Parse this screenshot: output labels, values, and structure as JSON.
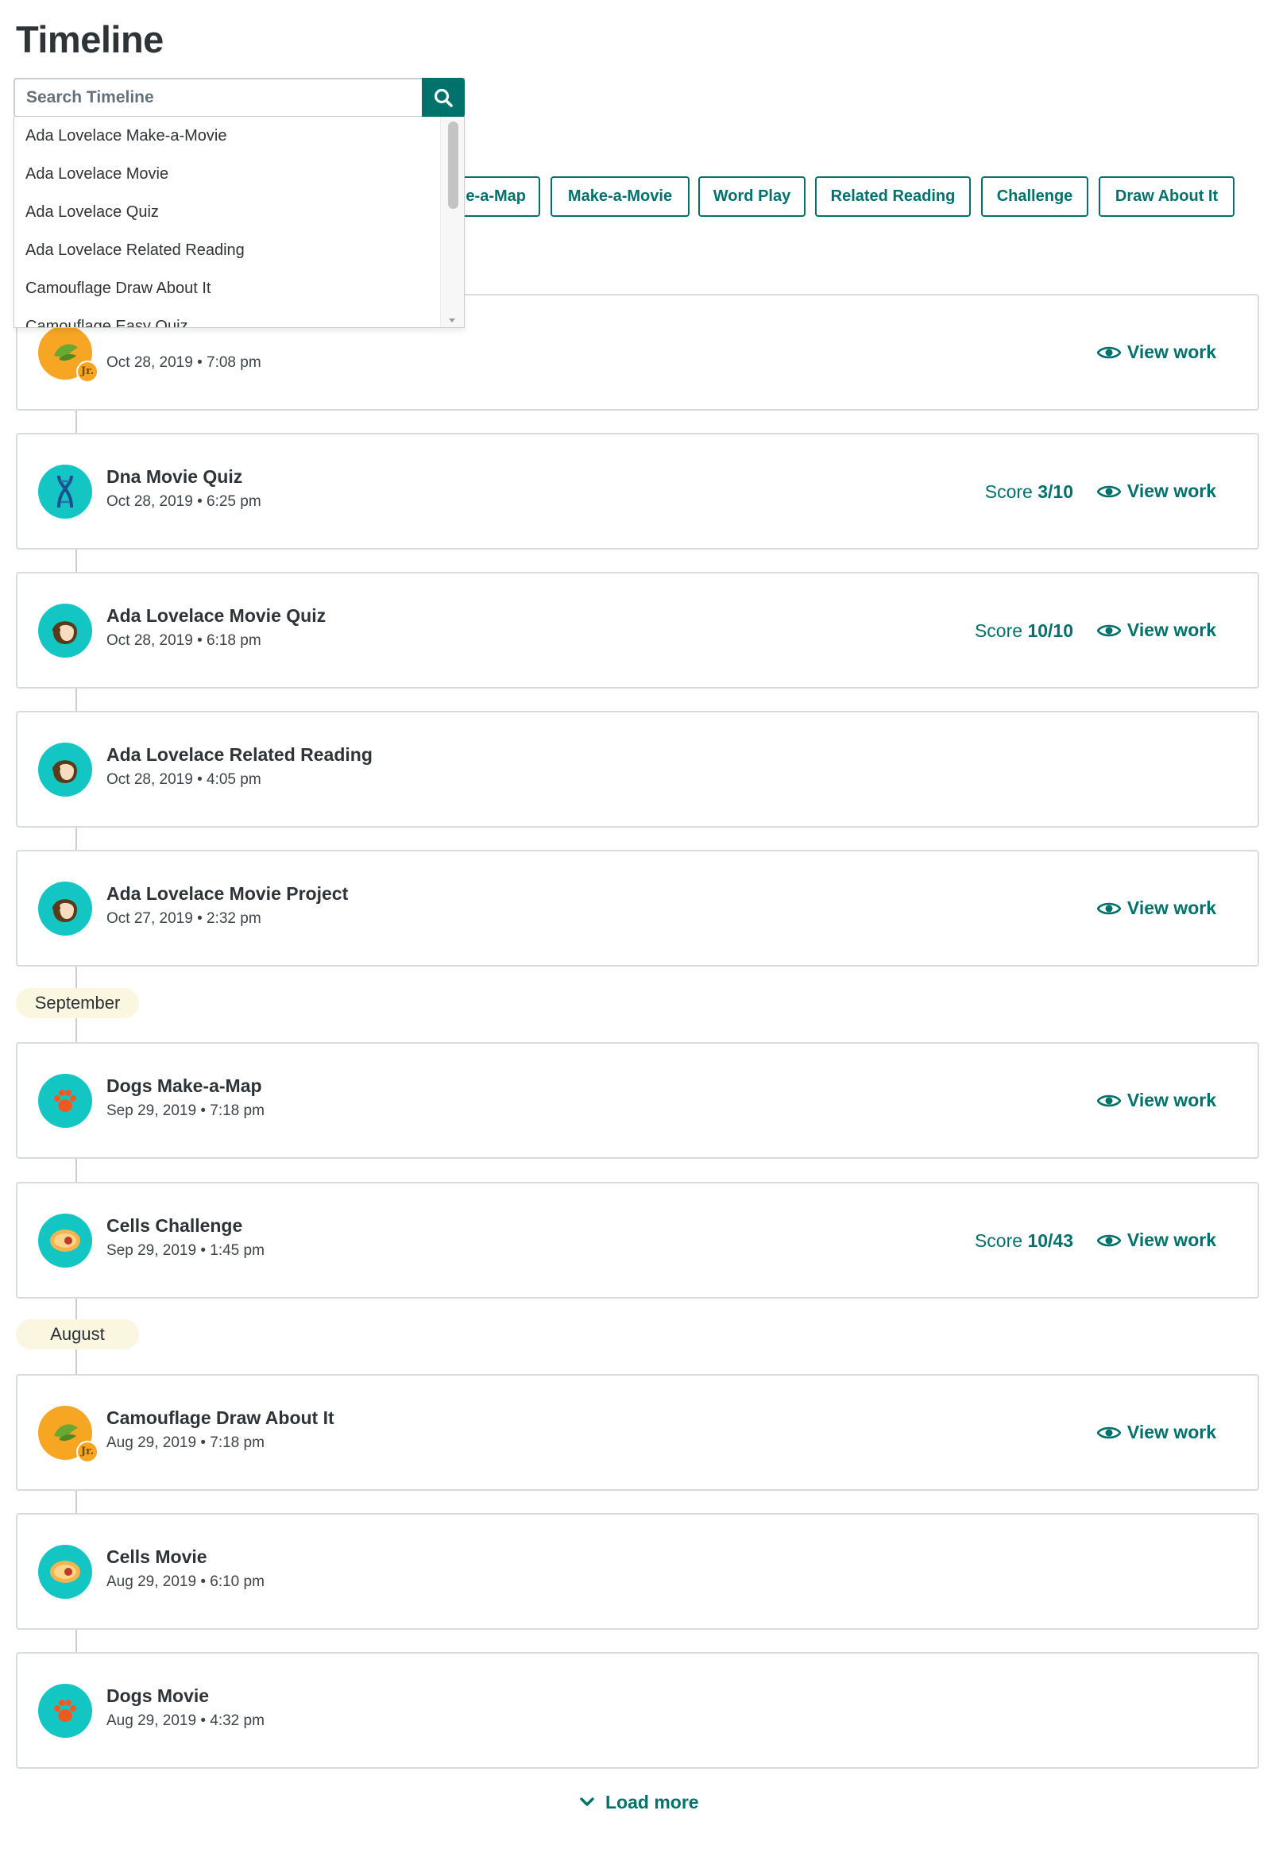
{
  "page": {
    "title": "Timeline"
  },
  "search": {
    "placeholder": "Search Timeline",
    "button_icon": "search-icon",
    "suggestions": [
      "Ada Lovelace Make-a-Movie",
      "Ada Lovelace Movie",
      "Ada Lovelace Quiz",
      "Ada Lovelace Related Reading",
      "Camouflage Draw About It",
      "Camouflage Easy Quiz"
    ]
  },
  "filters": [
    "e-a-Map",
    "Make-a-Movie",
    "Word Play",
    "Related Reading",
    "Challenge",
    "Draw About It"
  ],
  "view_work_label": "View work",
  "score_label": "Score",
  "months": [
    "September",
    "August"
  ],
  "entries": [
    {
      "title": "",
      "date": "Oct 28, 2019 • 7:08 pm",
      "icon": "camouflage-jr-icon",
      "score": null
    },
    {
      "title": "Dna Movie Quiz",
      "date": "Oct 28, 2019 • 6:25 pm",
      "icon": "dna-icon",
      "score": "3/10"
    },
    {
      "title": "Ada Lovelace Movie Quiz",
      "date": "Oct 28, 2019 • 6:18 pm",
      "icon": "ada-lovelace-icon",
      "score": "10/10"
    },
    {
      "title": "Ada Lovelace Related Reading",
      "date": "Oct 28, 2019 • 4:05 pm",
      "icon": "ada-lovelace-icon",
      "score": null
    },
    {
      "title": "Ada Lovelace Movie Project",
      "date": "Oct 27, 2019 • 2:32 pm",
      "icon": "ada-lovelace-icon",
      "score": null
    },
    {
      "title": "Dogs Make-a-Map",
      "date": "Sep 29, 2019 • 7:18 pm",
      "icon": "paw-icon",
      "score": null
    },
    {
      "title": "Cells Challenge",
      "date": "Sep 29, 2019 • 1:45 pm",
      "icon": "cell-icon",
      "score": "10/43"
    },
    {
      "title": "Camouflage Draw About It",
      "date": "Aug 29, 2019 • 7:18 pm",
      "icon": "camouflage-jr-icon",
      "score": null
    },
    {
      "title": "Cells Movie",
      "date": "Aug 29, 2019 • 6:10 pm",
      "icon": "cell-icon",
      "score": null
    },
    {
      "title": "Dogs Movie",
      "date": "Aug 29, 2019 • 4:32 pm",
      "icon": "paw-icon",
      "score": null
    }
  ],
  "load_more": "Load more",
  "jr_label": "Jr.",
  "colors": {
    "accent": "#00716b",
    "icon_teal": "#13c6c4",
    "icon_orange": "#f6a623",
    "month_pill": "#fbf6e0"
  }
}
